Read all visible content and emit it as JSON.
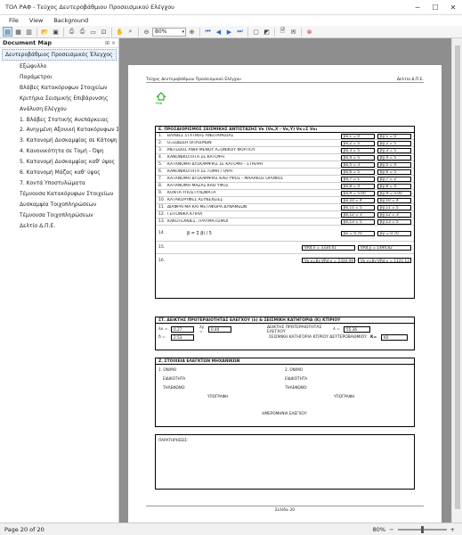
{
  "window": {
    "title": "ΤΟΛ ΡΑΦ - Τεύχος Δευτεροβάθμιου Προσεισμικού Ελέγχου"
  },
  "menu": [
    "File",
    "View",
    "Background"
  ],
  "toolbar": {
    "zoom": "80%"
  },
  "docmap": {
    "header": "Document Map",
    "pins": "⊞ ×",
    "root": "Δευτεροβάθμιος Προσεισμικός Έλεγχος",
    "items": [
      "Εξώφυλλο",
      "Παράμετροι",
      "Βλάβες Κατακόρυφων Στοιχείων",
      "Κριτήρια Σεισμικής Επιβάρυνσης",
      "Ανάλυση Ελέγχου",
      "1. Βλάβες Στατικής Ανεπάρκειας",
      "2. Ανηγμένη Αξονική Κατακόρυφων Στ...",
      "3. Κατανομή Δυσκαμψίας σε Κάτοψη - ...",
      "4. Κανονικότητα σε Τομή - Όψη",
      "5. Κατανομή Δυσκαμψίας καθ' ύψος",
      "6. Κατανομή Μάζας καθ' ύψος",
      "7. Κοντά Υποστυλώματα",
      "Τέμνουσα Κατακόρυφων Στοιχείων",
      "Δυσκαμψία Τοιχοπληρώσεων",
      "Τέμνουσα Τοιχοπληρώσεων",
      "Δελτίο Δ.Π.Ε."
    ]
  },
  "page": {
    "header_left": "Τεύχος Δευτεροβάθμιου Προσεισμικού Ελέγχου",
    "header_right": "Δελτίο Δ.Π.Ε.",
    "logo": "ΡΑΦ",
    "secE_title": "Ε.  ΠΡΟΣΔΙΟΡΙΣΜΟΣ ΣΕΙΣΜΙΚΗΣ ΑΝΤΙΣΤΑΣΗΣ  Vκ (Vκ,Χ - Vκ,Υ)   Vκ=Σ Vκι",
    "rows": [
      {
        "n": "1.",
        "label": "ΒΛΑΒΕΣ ΣΤΑΤΙΚΗΣ ΑΝΕΠΑΡΚΕΙΑΣ",
        "a": "βx,1 = 0",
        "b": "βy,1 = 0"
      },
      {
        "n": "2.",
        "label": "ΟΞΕΙΔΩΣΗ ΟΠΛΙΣΜΩΝ",
        "a": "βx,2 = 5",
        "b": "βy,2 = 5"
      },
      {
        "n": "3.",
        "label": "ΜΕΓΕΘΟΣ ΑΝΗΓΜΕΝΟΥ ΑΞΟΝΙΚΟΥ ΦΟΡΤΙΟΥ",
        "a": "βx,3 = 5",
        "b": "βy,3 = 5"
      },
      {
        "n": "4.",
        "label": "ΚΑΝΟΝΙΚΟΤΗΤΑ ΣΕ ΚΑΤΟΨΗ",
        "a": "βx,4 = 5",
        "b": "βy,4 = 5"
      },
      {
        "n": "5.",
        "label": "ΚΑΤΑΝΟΜΗ ΔΥΣΚΑΜΨΙΑΣ ΣΕ ΚΑΤΟΨΗ - ΣΤΡΕΨΗ",
        "a": "βx,5 = 3",
        "b": "βy,5 = 4"
      },
      {
        "n": "6.",
        "label": "ΚΑΝΟΝΙΚΟΤΗΤΑ ΣΕ ΤΟΜΗ / ΟΨΗ",
        "a": "βx,6 = 5",
        "b": "βy,6 = 5"
      },
      {
        "n": "7.",
        "label": "ΚΑΤΑΝΟΜΗ ΔΥΣΚΑΜΨΙΑΣ ΚΑΘ ΥΨΟΣ - ΜΑΛΑΚΟΣ ΟΡΟΦΟΣ",
        "a": "βx,7 = 1",
        "b": "βy,7 = 2"
      },
      {
        "n": "8.",
        "label": "ΚΑΤΑΝΟΜΗ ΜΑΖΑΣ ΚΑΘ ΥΨΟΣ",
        "a": "βx,8 = 4",
        "b": "βy,8 = 4"
      },
      {
        "n": "9.",
        "label": "ΚΟΝΤΑ ΥΠΟΣΤΥΛΩΜΑΤΑ",
        "a": "βx,9 = 5.00",
        "b": "βy,9 = 5.00"
      },
      {
        "n": "10.",
        "label": "ΚΑΤΑΚΟΡΥΦΕΣ ΑΣΥΝΕΧΕΙΕΣ",
        "a": "βx,10 = 4",
        "b": "βy,10 = 4"
      },
      {
        "n": "11.",
        "label": "ΔΙΑΦΡΑΓΜΑ ΚΑΙ ΜΕΤΑΦΟΡΑ ΔΥΝΑΜΕΩΝ",
        "a": "βx,11 = 5",
        "b": "βy,11 = 5"
      },
      {
        "n": "12.",
        "label": "ΓΕΙΤΟΝΙΚΑ ΚΤΙΡΙΑ",
        "a": "βx,12 = 3",
        "b": "βy,12 = 3"
      },
      {
        "n": "13.",
        "label": "ΚΑΚΟΤΕΧΝΙΕΣ, ΤΡΑΥΜΑΤΙΣΜΟΙ",
        "a": "βx,13 = 5",
        "b": "βy,13 = 5"
      }
    ],
    "r14_formula": "β = Σ βi / 5",
    "r14_a": "βx = 0.70",
    "r14_b": "βy = 0.70",
    "r15_a": "VRd,x = 3334.41",
    "r15_b": "VRd,y = 1494.82",
    "r16_a": "Vκ,x=βx·VRd,x = 2334.09",
    "r16_b": "Vκ,y=βy·VRd,y = 1121.12",
    "secST_title": "ΣΤ.  ΔΕΙΚΤΗΣ ΠΡΟΤΕΡΑΙΟΤΗΤΑΣ ΕΛΕΓΧΟΥ (λ) & ΣΕΙΣΜΙΚΗ ΚΑΤΗΓΟΡΙΑ (Κ) ΚΤΙΡΙΟΥ",
    "lx_label": "λx =",
    "lx_val": "0.27",
    "ly_label": "λy =",
    "ly_val": "0.40",
    "dpe_label": "ΔΕΙΚΤΗΣ ΠΡΟΤΕΡΑΙΟΤΗΤΑΣ ΕΛΕΓΧΟΥ",
    "dpe_sym": "λ =",
    "dpe_val": "55.36",
    "de_label": "δ =",
    "de_val": "2.53",
    "cat_label": "ΣΕΙΣΜΙΚΗ ΚΑΤΗΓΟΡΙΑ ΚΤΙΡΙΟΥ ΔΕΥΤΕΡΟΒΑΘΜΙΟΥ",
    "cat_sym": "K=",
    "cat_val": "K0",
    "secZ_title": "Ζ.  ΣΤΟΙΧΕΙΑ ΕΛΕΓΚΤΩΝ ΜΗΧΑΝΙΚΩΝ",
    "eng1": "1. ΟΝ/ΜΟ",
    "eng2": "2. ΟΝ/ΜΟ",
    "spec": "ΕΙΔΙΚΟΤΗΤΑ",
    "phone": "ΤΗΛΕΦΩΝΟ:",
    "sign": "ΥΠΟΓΡΑΦΗ",
    "date_label": "ΗΜΕΡΟΜΗΝΙΑ ΕΛΕΓΧΟΥ:",
    "notes": "ΠΑΡΑΤΗΡΗΣΕΙΣ:",
    "footer": "Σελίδα 20"
  },
  "status": {
    "page": "Page 20 of 20",
    "zoom": "80%"
  }
}
